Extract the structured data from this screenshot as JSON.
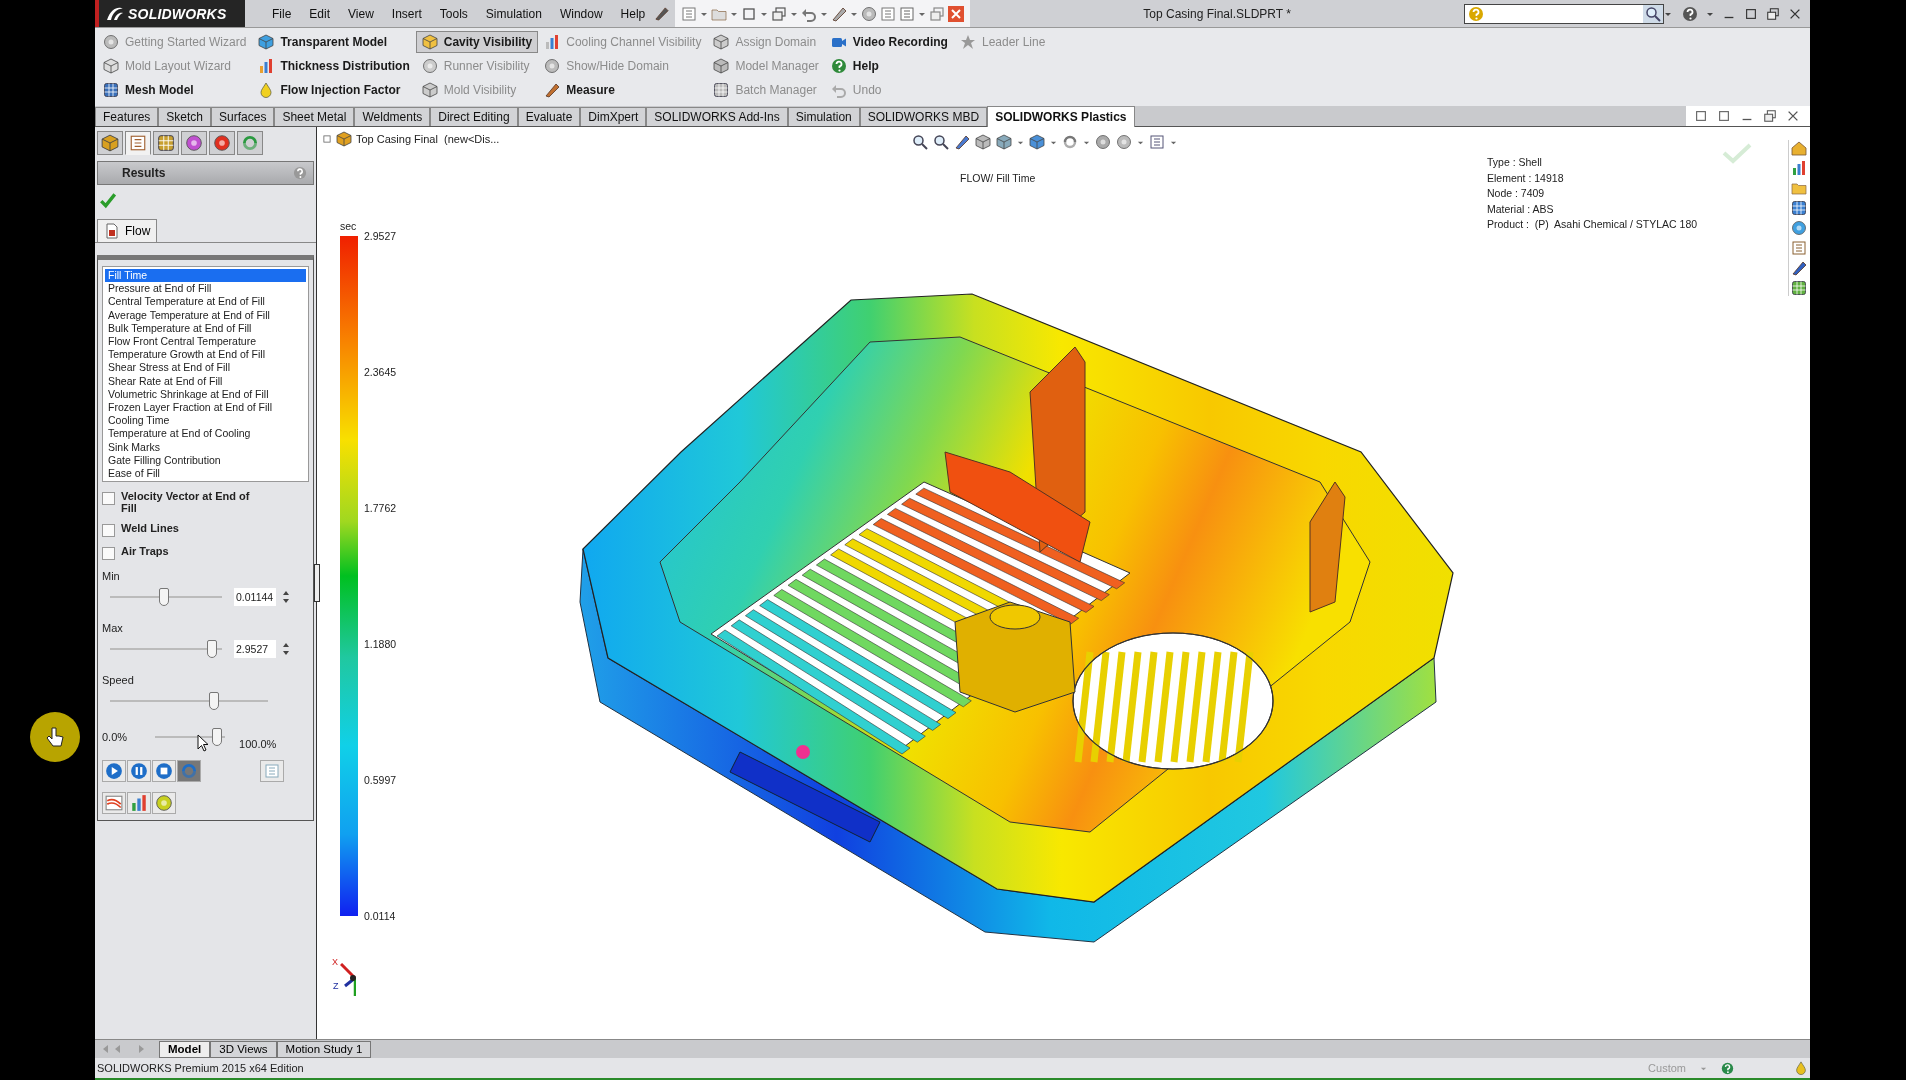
{
  "title_bar": {
    "logo": "SOLIDWORKS",
    "menus": [
      "File",
      "Edit",
      "View",
      "Insert",
      "Tools",
      "Simulation",
      "Window",
      "Help"
    ],
    "document_title": "Top Casing Final.SLDPRT *"
  },
  "ribbon": {
    "columns": [
      [
        {
          "label": "Getting Started Wizard",
          "disabled": true,
          "selected": false
        },
        {
          "label": "Mold Layout Wizard",
          "disabled": true,
          "selected": false
        },
        {
          "label": "Mesh Model",
          "disabled": false,
          "selected": false
        }
      ],
      [
        {
          "label": "Transparent Model",
          "disabled": false,
          "selected": false
        },
        {
          "label": "Thickness Distribution",
          "disabled": false,
          "selected": false
        },
        {
          "label": "Flow Injection Factor",
          "disabled": false,
          "selected": false
        }
      ],
      [
        {
          "label": "Cavity Visibility",
          "disabled": false,
          "selected": true
        },
        {
          "label": "Runner Visibility",
          "disabled": true,
          "selected": false
        },
        {
          "label": "Mold Visibility",
          "disabled": true,
          "selected": false
        }
      ],
      [
        {
          "label": "Cooling Channel Visibility",
          "disabled": true,
          "selected": false
        },
        {
          "label": "Show/Hide Domain",
          "disabled": true,
          "selected": false
        },
        {
          "label": "Measure",
          "disabled": false,
          "selected": false
        }
      ],
      [
        {
          "label": "Assign Domain",
          "disabled": true,
          "selected": false
        },
        {
          "label": "Model Manager",
          "disabled": true,
          "selected": false
        },
        {
          "label": "Batch Manager",
          "disabled": true,
          "selected": false
        }
      ],
      [
        {
          "label": "Video Recording",
          "disabled": false,
          "selected": false
        },
        {
          "label": "Help",
          "disabled": false,
          "selected": false
        },
        {
          "label": "Undo",
          "disabled": true,
          "selected": false
        }
      ],
      [
        {
          "label": "Leader Line",
          "disabled": true,
          "selected": false
        }
      ]
    ]
  },
  "command_tabs": [
    {
      "label": "Features",
      "selected": false
    },
    {
      "label": "Sketch",
      "selected": false
    },
    {
      "label": "Surfaces",
      "selected": false
    },
    {
      "label": "Sheet Metal",
      "selected": false
    },
    {
      "label": "Weldments",
      "selected": false
    },
    {
      "label": "Direct Editing",
      "selected": false
    },
    {
      "label": "Evaluate",
      "selected": false
    },
    {
      "label": "DimXpert",
      "selected": false
    },
    {
      "label": "SOLIDWORKS Add-Ins",
      "selected": false
    },
    {
      "label": "Simulation",
      "selected": false
    },
    {
      "label": "SOLIDWORKS MBD",
      "selected": false
    },
    {
      "label": "SOLIDWORKS Plastics",
      "selected": true
    }
  ],
  "manager_tabs": [
    {
      "selected": false
    },
    {
      "selected": true
    },
    {
      "selected": false
    },
    {
      "selected": false
    },
    {
      "selected": false
    },
    {
      "selected": false
    }
  ],
  "property_manager": {
    "title": "Results",
    "flow_tab": "Flow",
    "results": [
      {
        "label": "Fill Time",
        "selected": true
      },
      {
        "label": "Pressure at End of Fill",
        "selected": false
      },
      {
        "label": "Central Temperature at End of Fill",
        "selected": false
      },
      {
        "label": "Average Temperature at End of Fill",
        "selected": false
      },
      {
        "label": "Bulk Temperature at End of Fill",
        "selected": false
      },
      {
        "label": "Flow Front Central Temperature",
        "selected": false
      },
      {
        "label": "Temperature Growth at End of Fill",
        "selected": false
      },
      {
        "label": "Shear Stress at End of Fill",
        "selected": false
      },
      {
        "label": "Shear Rate at End of Fill",
        "selected": false
      },
      {
        "label": "Volumetric Shrinkage at End of Fill",
        "selected": false
      },
      {
        "label": "Frozen Layer Fraction at End of Fill",
        "selected": false
      },
      {
        "label": "Cooling Time",
        "selected": false
      },
      {
        "label": "Temperature at End of Cooling",
        "selected": false
      },
      {
        "label": "Sink Marks",
        "selected": false
      },
      {
        "label": "Gate Filling Contribution",
        "selected": false
      },
      {
        "label": "Ease of Fill",
        "selected": false
      }
    ],
    "options": [
      {
        "label": "Velocity Vector at End of Fill",
        "checked": false
      },
      {
        "label": "Weld Lines",
        "checked": false
      },
      {
        "label": "Air Traps",
        "checked": false
      }
    ],
    "min": {
      "label": "Min",
      "level": 0.48,
      "value": "0.01144"
    },
    "max": {
      "label": "Max",
      "level": 0.95,
      "value": "2.9527"
    },
    "speed": {
      "label": "Speed",
      "level": 0.67
    },
    "progress": {
      "start": "0.0%",
      "end": "100.0%",
      "level": 0.95
    },
    "playback": [
      {
        "selected": false
      },
      {
        "selected": false
      },
      {
        "selected": false
      },
      {
        "selected": true
      }
    ]
  },
  "graphics": {
    "document": "Top Casing Final  (new<Dis...",
    "view_title": "FLOW/ Fill Time",
    "legend": {
      "unit": "sec",
      "labels": [
        "2.9527",
        "2.3645",
        "1.7762",
        "1.1880",
        "0.5997",
        "0.0114"
      ]
    },
    "info": [
      "Type : Shell",
      "Element : 14918",
      "Node : 7409",
      "Material : ABS",
      "Product :  (P)  Asahi Chemical / STYLAC 180"
    ],
    "axes": [
      "X",
      "Z"
    ]
  },
  "bottom_tabs": [
    {
      "label": "Model",
      "selected": true
    },
    {
      "label": "3D Views",
      "selected": false
    },
    {
      "label": "Motion Study 1",
      "selected": false
    }
  ],
  "status_bar": {
    "text": "SOLIDWORKS Premium 2015 x64 Edition",
    "units": "Custom"
  }
}
